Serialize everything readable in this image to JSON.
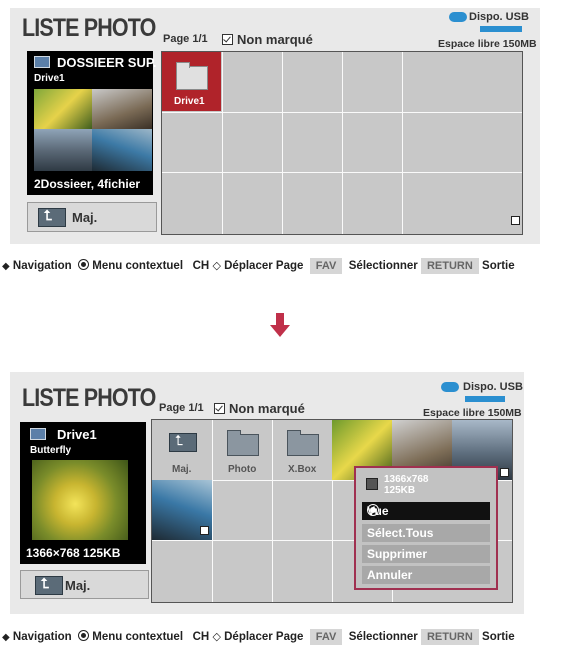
{
  "screen1": {
    "title": "LISTE PHOTO",
    "page": "Page 1/1",
    "unmarked": "Non marqué",
    "device": "Dispo. USB",
    "free_space": "Espace libre 150MB",
    "info": {
      "title": "DOSSIEER SUP.",
      "drive": "Drive1",
      "count": "2Dossieer, 4fichier"
    },
    "maj": "Maj.",
    "selected_folder": "Drive1"
  },
  "screen2": {
    "title": "LISTE PHOTO",
    "page": "Page 1/1",
    "unmarked": "Non marqué",
    "device": "Dispo. USB",
    "free_space": "Espace libre 150MB",
    "info": {
      "title": "Drive1",
      "sub": "Butterfly",
      "foot": "1366×768  125KB"
    },
    "maj": "Maj.",
    "folders": [
      "Maj.",
      "Photo",
      "X.Box"
    ],
    "context_menu": {
      "info_resolution": "1366x768",
      "info_size": "125KB",
      "items": [
        "Vue",
        "Sélect.Tous",
        "Supprimer",
        "Annuler"
      ],
      "selected": "Vue"
    }
  },
  "nav": {
    "navigation": "Navigation",
    "menu": "Menu contextuel",
    "ch": "CH",
    "move_page": "Déplacer Page",
    "fav": "FAV",
    "select": "Sélectionner",
    "return_key": "RETURN",
    "exit": "Sortie"
  },
  "colors": {
    "accent_red": "#b0232a",
    "menu_border": "#a03050",
    "usb_blue": "#2b8fd0"
  }
}
